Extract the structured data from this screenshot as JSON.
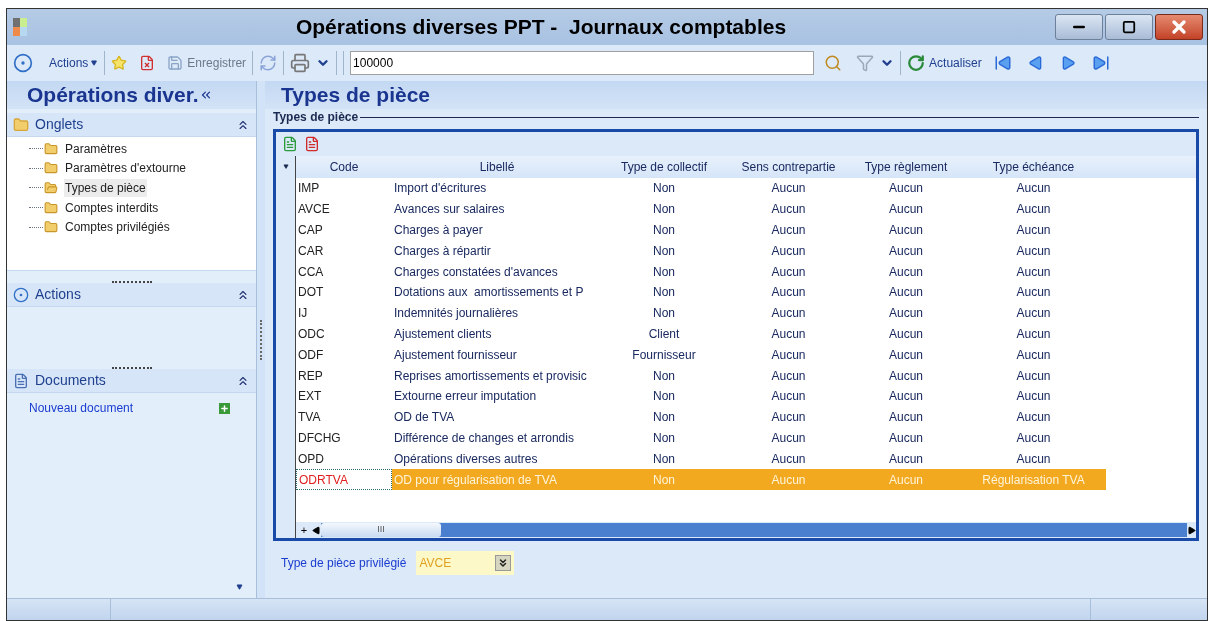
{
  "window": {
    "title": "Opérations diverses PPT -  Journaux comptables"
  },
  "toolbar": {
    "actions_menu": "Actions",
    "save": "Enregistrer",
    "search_value": "100000",
    "refresh": "Actualiser"
  },
  "sidebar": {
    "title": "Opérations diver.",
    "sections": [
      {
        "kind": "tree",
        "title": "Onglets",
        "items": [
          {
            "label": "Paramètres",
            "selected": false
          },
          {
            "label": "Paramètres d'extourne",
            "selected": false
          },
          {
            "label": "Types de pièce",
            "selected": true
          },
          {
            "label": "Comptes interdits",
            "selected": false
          },
          {
            "label": "Comptes privilégiés",
            "selected": false
          }
        ]
      },
      {
        "kind": "actions",
        "title": "Actions"
      },
      {
        "kind": "links",
        "title": "Documents",
        "link": "Nouveau document"
      }
    ]
  },
  "content": {
    "title": "Types de pièce",
    "group_title": "Types de pièce",
    "table": {
      "columns": [
        "Code",
        "Libellé",
        "Type de collectif",
        "Sens contrepartie",
        "Type règlement",
        "Type échéance"
      ],
      "rows": [
        {
          "cells": [
            "IMP",
            "Import d'écritures",
            "Non",
            "Aucun",
            "Aucun",
            "Aucun"
          ],
          "selected": false
        },
        {
          "cells": [
            "AVCE",
            "Avances sur salaires",
            "Non",
            "Aucun",
            "Aucun",
            "Aucun"
          ],
          "selected": false
        },
        {
          "cells": [
            "CAP",
            "Charges à payer",
            "Non",
            "Aucun",
            "Aucun",
            "Aucun"
          ],
          "selected": false
        },
        {
          "cells": [
            "CAR",
            "Charges à répartir",
            "Non",
            "Aucun",
            "Aucun",
            "Aucun"
          ],
          "selected": false
        },
        {
          "cells": [
            "CCA",
            "Charges constatées d'avances",
            "Non",
            "Aucun",
            "Aucun",
            "Aucun"
          ],
          "selected": false
        },
        {
          "cells": [
            "DOT",
            "Dotations aux  amortissements et P",
            "Non",
            "Aucun",
            "Aucun",
            "Aucun"
          ],
          "selected": false
        },
        {
          "cells": [
            "IJ",
            "Indemnités journalières",
            "Non",
            "Aucun",
            "Aucun",
            "Aucun"
          ],
          "selected": false
        },
        {
          "cells": [
            "ODC",
            "Ajustement clients",
            "Client",
            "Aucun",
            "Aucun",
            "Aucun"
          ],
          "selected": false
        },
        {
          "cells": [
            "ODF",
            "Ajustement fournisseur",
            "Fournisseur",
            "Aucun",
            "Aucun",
            "Aucun"
          ],
          "selected": false
        },
        {
          "cells": [
            "REP",
            "Reprises amortissements et provisic",
            "Non",
            "Aucun",
            "Aucun",
            "Aucun"
          ],
          "selected": false
        },
        {
          "cells": [
            "EXT",
            "Extourne erreur imputation",
            "Non",
            "Aucun",
            "Aucun",
            "Aucun"
          ],
          "selected": false
        },
        {
          "cells": [
            "TVA",
            "OD de TVA",
            "Non",
            "Aucun",
            "Aucun",
            "Aucun"
          ],
          "selected": false
        },
        {
          "cells": [
            "DFCHG",
            "Différence de changes et arrondis",
            "Non",
            "Aucun",
            "Aucun",
            "Aucun"
          ],
          "selected": false
        },
        {
          "cells": [
            "OPD",
            "Opérations diverses autres",
            "Non",
            "Aucun",
            "Aucun",
            "Aucun"
          ],
          "selected": false
        },
        {
          "cells": [
            "ODRTVA",
            "OD pour régularisation de TVA",
            "Non",
            "Aucun",
            "Aucun",
            "Régularisation TVA"
          ],
          "selected": true
        }
      ]
    },
    "add_row": "+",
    "scrollbar_grip": "III",
    "preferred": {
      "label": "Type de pièce privilégié",
      "value": "AVCE"
    }
  }
}
